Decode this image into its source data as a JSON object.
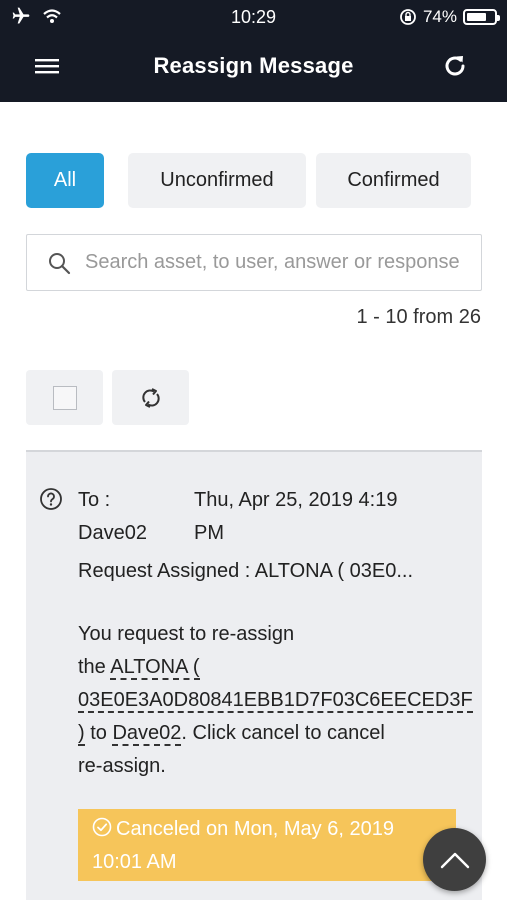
{
  "status_bar": {
    "time": "10:29",
    "battery_percent": "74%",
    "battery_level": 0.74,
    "icons": [
      "airplane-icon",
      "wifi-icon",
      "orientation-lock-icon",
      "battery-icon"
    ]
  },
  "header": {
    "title": "Reassign Message",
    "left_icon": "menu-icon",
    "right_icon": "refresh-icon"
  },
  "filters": {
    "tabs": [
      {
        "label": "All",
        "active": true
      },
      {
        "label": "Unconfirmed",
        "active": false
      },
      {
        "label": "Confirmed",
        "active": false
      }
    ]
  },
  "search": {
    "placeholder": "Search asset, to user, answer or response",
    "value": ""
  },
  "pagination": {
    "summary": "1 - 10 from 26"
  },
  "toolbar": {
    "icons": [
      "select-all-checkbox",
      "sync-icon"
    ]
  },
  "messages": [
    {
      "to_label": "To :",
      "to_user": "Dave02",
      "date_line1": "Thu, Apr 25, 2019 4:19",
      "date_line2": "PM",
      "subject": "Request Assigned : ALTONA ( 03E0...",
      "body_intro": "You request to re-assign",
      "body_the": "the ",
      "asset_name": "ALTONA (",
      "asset_id": "03E0E3A0D80841EBB1D7F03C6EECED3F",
      "asset_close": ")",
      "body_to": " to ",
      "body_user": "Dave02",
      "body_rest": ". Click cancel to cancel",
      "body_end": "re-assign.",
      "status_line1": "Canceled on Mon, May 6, 2019",
      "status_line2": "10:01 AM",
      "status_color": "#f6c55a"
    }
  ],
  "colors": {
    "header_bg": "#151a25",
    "accent": "#2aa0d9",
    "tab_bg": "#f0f1f3",
    "card_bg": "#edeef1"
  },
  "fab": {
    "icon": "chevron-up-icon"
  }
}
